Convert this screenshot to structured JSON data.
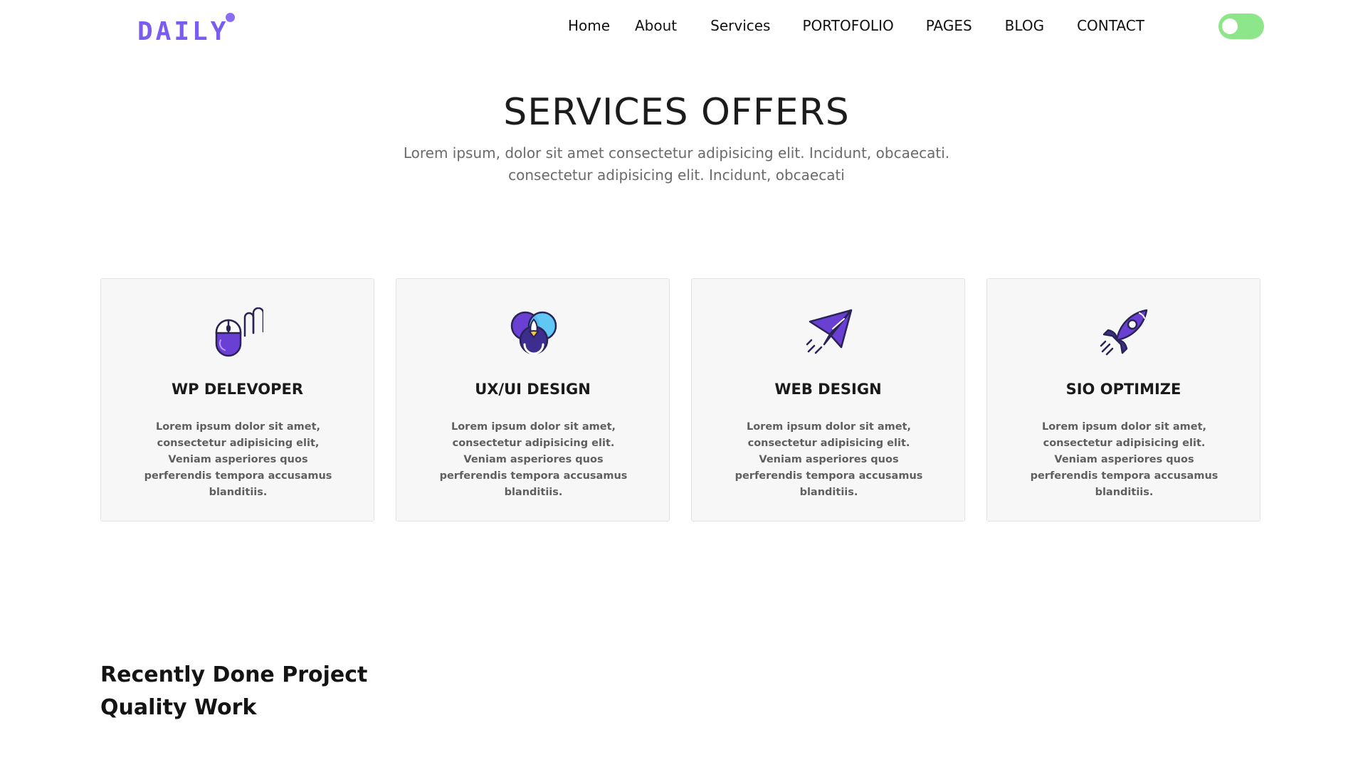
{
  "brand": {
    "logo_text": "DAILY",
    "logo_color": "#7a5cf0"
  },
  "nav": {
    "items": [
      {
        "label": "Home"
      },
      {
        "label": "About"
      },
      {
        "label": "Services"
      },
      {
        "label": "PORTOFOLIO"
      },
      {
        "label": "PAGES"
      },
      {
        "label": "BLOG"
      },
      {
        "label": "CONTACT"
      }
    ],
    "theme_toggle": {
      "state": "off",
      "color": "#8ee68a"
    }
  },
  "services": {
    "title": "SERVICES OFFERS",
    "subtitle_line1": "Lorem ipsum, dolor sit amet consectetur adipisicing elit. Incidunt, obcaecati.",
    "subtitle_line2": "consectetur adipisicing elit. Incidunt, obcaecati",
    "cards": [
      {
        "icon": "mouse-icon",
        "title": "WP DELEVOPER",
        "text": "Lorem ipsum dolor sit amet, consectetur adipisicing elit, Veniam asperiores quos perferendis tempora accusamus blanditiis."
      },
      {
        "icon": "color-circles-icon",
        "title": "UX/UI DESIGN",
        "text": "Lorem ipsum dolor sit amet, consectetur adipisicing elit. Veniam asperiores quos perferendis tempora accusamus blanditiis."
      },
      {
        "icon": "paper-plane-icon",
        "title": "WEB DESIGN",
        "text": "Lorem ipsum dolor sit amet, consectetur adipisicing elit. Veniam asperiores quos perferendis tempora accusamus blanditiis."
      },
      {
        "icon": "rocket-icon",
        "title": "SIO OPTIMIZE",
        "text": "Lorem ipsum dolor sit amet, consectetur adipisicing elit. Veniam asperiores quos perferendis tempora accusamus blanditiis."
      }
    ]
  },
  "projects": {
    "heading_line1": "Recently Done Project",
    "heading_line2": "Quality Work"
  },
  "colors": {
    "accent_purple": "#6c3fd6",
    "accent_blue": "#55c3f0",
    "card_bg": "#f7f7f7"
  }
}
